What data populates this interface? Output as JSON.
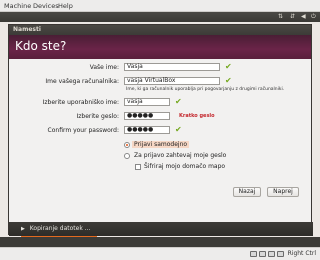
{
  "vbox": {
    "menu": [
      "Machine",
      "Devices",
      "Help"
    ],
    "host_key": "Right Ctrl"
  },
  "dialog": {
    "window_title": "Namesti",
    "heading": "Kdo ste?"
  },
  "form": {
    "name_label": "Vaše ime:",
    "name_value": "Vasja",
    "computer_label": "Ime vašega računalnika:",
    "computer_value": "vasja VirtualBox",
    "computer_hint": "Ime, ki ga računalnik uporablja pri pogovarjanju z drugimi računalniki.",
    "username_label": "Izberite uporabniško ime:",
    "username_value": "vasja",
    "password_label": "Izberite geslo:",
    "password_value": "●●●●●",
    "password_strength": "Kratko geslo",
    "confirm_label": "Confirm your password:",
    "confirm_value": "●●●●●"
  },
  "options": {
    "auto_login": "Prijavi samodejno",
    "require_password": "Za prijavo zahtevaj moje geslo",
    "encrypt_home": "Šifriraj mojo domačo mapo"
  },
  "buttons": {
    "back": "Nazaj",
    "next": "Naprej"
  },
  "status": {
    "text": "Kopiranje datotek ..."
  },
  "icons": {
    "check": "✔",
    "expander": "▶"
  },
  "colors": {
    "check_green": "#75a81f",
    "header_aubergine": "#5a1f3b",
    "progress_orange": "#e36a1f",
    "weak_password_red": "#c4252b"
  }
}
